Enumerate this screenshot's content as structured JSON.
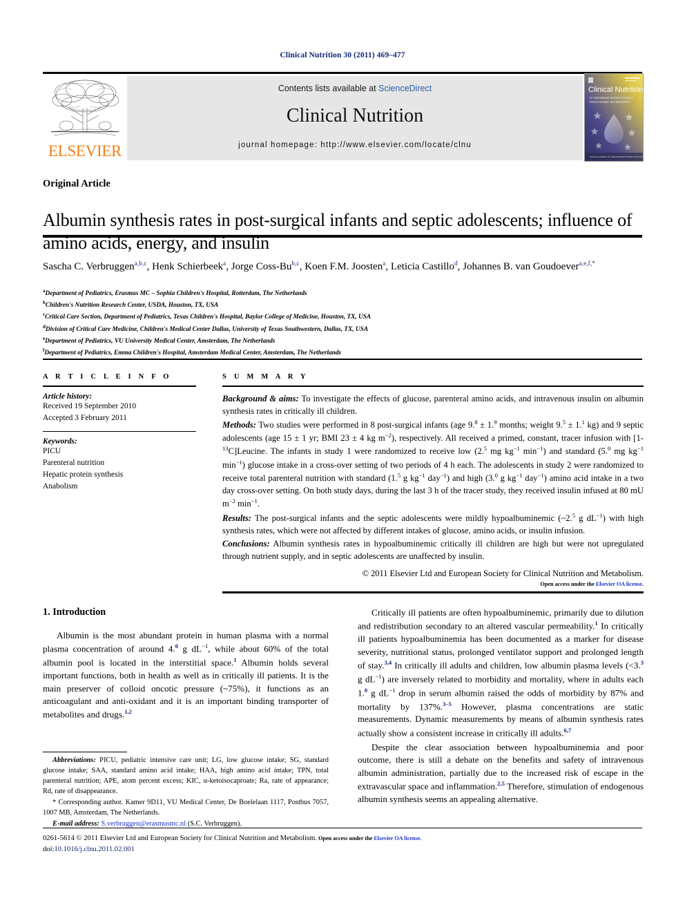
{
  "running_head": "Clinical Nutrition 30 (2011) 469–477",
  "masthead": {
    "contents_prefix": "Contents lists available at ",
    "sciencedirect": "ScienceDirect",
    "journal_title": "Clinical Nutrition",
    "homepage": "journal homepage: http://www.elsevier.com/locate/clnu",
    "publisher_name": "ELSEVIER",
    "publisher_color": "#f07f1a",
    "cover": {
      "title": "Clinical Nutrition",
      "subtitle_line1": "An International Journal Devoted to",
      "subtitle_line2": "Clinical Nutrition and Metabolism",
      "footer_strip": "OFFICIAL JOURNAL OF THE EUROPEAN SOCIETY FOR CLINICAL NUTRITION AND METABOLISM"
    }
  },
  "article": {
    "type": "Original Article",
    "title": "Albumin synthesis rates in post-surgical infants and septic adolescents; influence of amino acids, energy, and insulin",
    "authors": [
      {
        "name": "Sascha C. Verbruggen",
        "sup": "a,b,c",
        "sep": ", "
      },
      {
        "name": "Henk Schierbeek",
        "sup": "a",
        "sep": ", "
      },
      {
        "name": "Jorge Coss-Bu",
        "sup": "b,c",
        "sep": ", "
      },
      {
        "name": "Koen F.M. Joosten",
        "sup": "a",
        "sep": ", "
      },
      {
        "name": "Leticia Castillo",
        "sup": "d",
        "sep": ", "
      },
      {
        "name": "Johannes B. van Goudoever",
        "sup": "a,e,f,*",
        "sep": ""
      }
    ],
    "affiliations": [
      {
        "mark": "a",
        "text": "Department of Pediatrics, Erasmus MC – Sophia Children's Hospital, Rotterdam, The Netherlands"
      },
      {
        "mark": "b",
        "text": "Children's Nutrition Research Center, USDA, Houston, TX, USA"
      },
      {
        "mark": "c",
        "text": "Critical Care Section, Department of Pediatrics, Texas Children's Hospital, Baylor College of Medicine, Houston, TX, USA"
      },
      {
        "mark": "d",
        "text": "Division of Critical Care Medicine, Children's Medical Center Dallas, University of Texas Southwestern, Dallas, TX, USA"
      },
      {
        "mark": "e",
        "text": "Department of Pediatrics, VU University Medical Center, Amsterdam, The Netherlands"
      },
      {
        "mark": "f",
        "text": "Department of Pediatrics, Emma Children's Hospital, Amsterdam Medical Center, Amsterdam, The Netherlands"
      }
    ]
  },
  "article_info": {
    "heading": "A R T I C L E   I N F O",
    "history_label": "Article history:",
    "received": "Received 19 September 2010",
    "accepted": "Accepted 3 February 2011",
    "keywords_label": "Keywords:",
    "keywords": [
      "PICU",
      "Parenteral nutrition",
      "Hepatic protein synthesis",
      "Anabolism"
    ]
  },
  "summary": {
    "heading": "S U M M A R Y",
    "background_label": "Background & aims:",
    "background_text": " To investigate the effects of glucose, parenteral amino acids, and intravenous insulin on albumin synthesis rates in critically ill children.",
    "methods_label": "Methods:",
    "methods_text": " Two studies were performed in 8 post-surgical infants (age 9.8 ± 1.9 months; weight 9.5 ± 1.1 kg) and 9 septic adolescents (age 15 ± 1 yr; BMI 23 ± 4 kg m−2), respectively. All received a primed, constant, tracer infusion with [1-13C]Leucine. The infants in study 1 were randomized to receive low (2.5 mg kg−1 min−1) and standard (5.0 mg kg−1 min−1) glucose intake in a cross-over setting of two periods of 4 h each. The adolescents in study 2 were randomized to receive total parenteral nutrition with standard (1.5 g kg−1 day−1) and high (3.0 g kg−1 day−1) amino acid intake in a two day cross-over setting. On both study days, during the last 3 h of the tracer study, they received insulin infused at 80 mU m−2 min−1.",
    "results_label": "Results:",
    "results_text": " The post-surgical infants and the septic adolescents were mildly hypoalbuminemic (~2.5 g dL−1) with high synthesis rates, which were not affected by different intakes of glucose, amino acids, or insulin infusion.",
    "conclusions_label": "Conclusions:",
    "conclusions_text": " Albumin synthesis rates in hypoalbuminemic critically ill children are high but were not upregulated through nutrient supply, and in septic adolescents are unaffected by insulin.",
    "copyright": "© 2011 Elsevier Ltd and European Society for Clinical Nutrition and Metabolism.",
    "open_access_prefix": "Open access under the ",
    "open_access_link": "Elsevier OA license."
  },
  "introduction": {
    "heading": "1. Introduction",
    "left_paragraphs": [
      "Albumin is the most abundant protein in human plasma with a normal plasma concentration of around 4.0 g dL−1, while about 60% of the total albumin pool is located in the interstitial space.1 Albumin holds several important functions, both in health as well as in critically ill patients. It is the main preserver of colloid oncotic pressure (~75%), it functions as an anticoagulant and anti-oxidant and it is an important binding transporter of metabolites and drugs.1,2"
    ],
    "right_paragraphs": [
      "Critically ill patients are often hypoalbuminemic, primarily due to dilution and redistribution secondary to an altered vascular permeability.1 In critically ill patients hypoalbuminemia has been documented as a marker for disease severity, nutritional status, prolonged ventilator support and prolonged length of stay.3,4 In critically ill adults and children, low albumin plasma levels (<3.3 g dL−1) are inversely related to morbidity and mortality, where in adults each 1.0 g dL−1 drop in serum albumin raised the odds of morbidity by 87% and mortality by 137%.3–5 However, plasma concentrations are static measurements. Dynamic measurements by means of albumin synthesis rates actually show a consistent increase in critically ill adults.6,7",
      "Despite the clear association between hypoalbuminemia and poor outcome, there is still a debate on the benefits and safety of intravenous albumin administration, partially due to the increased risk of escape in the extravascular space and inflammation.2,5 Therefore, stimulation of endogenous albumin synthesis seems an appealing alternative."
    ]
  },
  "footnotes": {
    "abbrev_label": "Abbreviations:",
    "abbrev_text": " PICU, pediatric intensive care unit; LG, low glucose intake; SG, standard glucose intake; SAA, standard amino acid intake; HAA, high amino acid intake; TPN, total parenteral nutrition; APE, atom percent excess; KIC, α-ketoisocaproate; Ra, rate of appearance; Rd, rate of disappearance.",
    "corresponding": "* Corresponding author. Kamer 9D11, VU Medical Center, De Boelelaan 1117, Postbus 7057, 1007 MB, Amsterdam, The Netherlands.",
    "email_label": "E-mail address:",
    "email": "S.verbruggen@erasmusmc.nl",
    "email_suffix": " (S.C. Verbruggen)."
  },
  "footer": {
    "issn_copyright": "0261-5614 © 2011 Elsevier Ltd and European Society for Clinical Nutrition and Metabolism.",
    "open_access_prefix": "Open access under the ",
    "open_access_link": "Elsevier OA license.",
    "doi_label": "doi:",
    "doi": "10.1016/j.clnu.2011.02.001"
  },
  "colors": {
    "link": "#1a32c8",
    "ref_sup": "#13267a",
    "elsevier_orange": "#f07f1a",
    "panel_grey": "#e6e6e6",
    "sciencedirect_blue": "#2a5caa"
  }
}
